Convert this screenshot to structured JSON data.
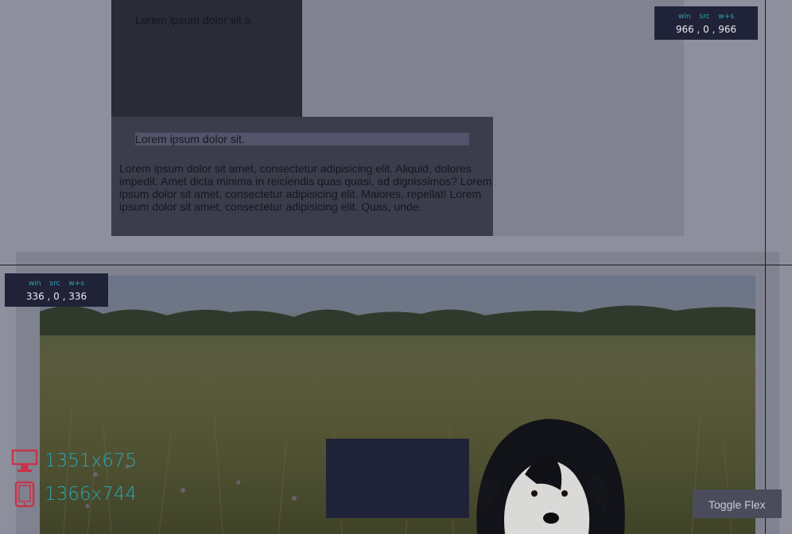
{
  "upper": {
    "dark_box_text": "Lorem ipsum dolor sit a",
    "heading": "Lorem ipsum dolor sit.",
    "paragraph": "Lorem ipsum dolor sit amet, consectetur adipisicing elit. Aliquid, dolores impedit. Amet dicta minima in reiciendis quas quasi, ad dignissimos? Lorem ipsum dolor sit amet, consectetur adipisicing elit. Maiores, repellat! Lorem ipsum dolor sit amet, consectetur adipisicing elit. Quas, unde."
  },
  "readout_top": {
    "labels": "win src w+s",
    "values": "966 , 0 , 966"
  },
  "readout_left": {
    "labels": "win src w+s",
    "values": "336 , 0 , 336"
  },
  "size_panel": {
    "desktop_icon": "monitor-icon",
    "desktop_size": "1351x675",
    "tablet_icon": "tablet-icon",
    "tablet_size": "1366x744"
  },
  "toggle_button": "Toggle Flex",
  "colors": {
    "accent_teal": "#2aa6b4",
    "icon_red": "#c8334a",
    "panel_navy": "#202338"
  }
}
